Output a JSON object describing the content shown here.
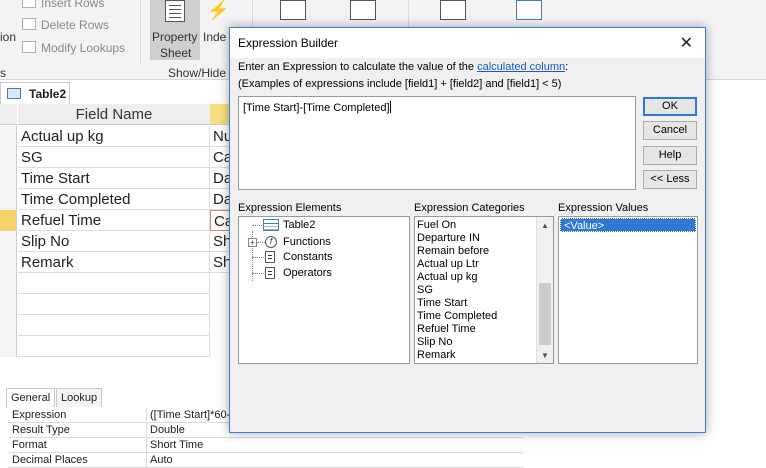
{
  "ribbon": {
    "insert_rows": "Insert Rows",
    "delete_rows": "Delete Rows",
    "modify_lookups": "Modify Lookups",
    "cut_label_left": "ion",
    "property_sheet_line1": "Property",
    "property_sheet_line2": "Sheet",
    "indexes_partial": "Inde",
    "show_hide_group": "Show/Hide",
    "left_group_partial": "s"
  },
  "object_tab": {
    "label": "Table2"
  },
  "grid": {
    "header_field_name": "Field Name",
    "rows": [
      {
        "name": "Actual up kg",
        "type": "Nu"
      },
      {
        "name": "SG",
        "type": "Ca"
      },
      {
        "name": "Time Start",
        "type": "Da"
      },
      {
        "name": "Time Completed",
        "type": "Da"
      },
      {
        "name": "Refuel Time",
        "type": "Ca"
      },
      {
        "name": "Slip No",
        "type": "Sh"
      },
      {
        "name": "Remark",
        "type": "Sh"
      }
    ]
  },
  "properties": {
    "tab_general": "General",
    "tab_lookup": "Lookup",
    "rows": [
      {
        "label": "Expression",
        "value": "([Time Start]*60-["
      },
      {
        "label": "Result Type",
        "value": "Double"
      },
      {
        "label": "Format",
        "value": "Short Time"
      },
      {
        "label": "Decimal Places",
        "value": "Auto"
      }
    ]
  },
  "dialog": {
    "title": "Expression Builder",
    "intro_prefix": "Enter an Expression to calculate the value of the ",
    "intro_link": "calculated column",
    "intro_suffix": ":",
    "examples": "(Examples of expressions include [field1] + [field2] and [field1] < 5)",
    "expression": "[Time Start]-[Time Completed]",
    "buttons": {
      "ok": "OK",
      "cancel": "Cancel",
      "help": "Help",
      "less": "<< Less"
    },
    "elements_label": "Expression Elements",
    "categories_label": "Expression Categories",
    "values_label": "Expression Values",
    "elements": [
      "Table2",
      "Functions",
      "Constants",
      "Operators"
    ],
    "categories": [
      "Fuel On",
      "Departure IN",
      "Remain before",
      "Actual up Ltr",
      "Actual up kg",
      "SG",
      "Time Start",
      "Time Completed",
      "Refuel Time",
      "Slip No",
      "Remark"
    ],
    "values": [
      "<Value>"
    ]
  },
  "colors": {
    "accent": "#3078d2",
    "link": "#1a57c8",
    "field_highlight": "#f8de7e"
  }
}
